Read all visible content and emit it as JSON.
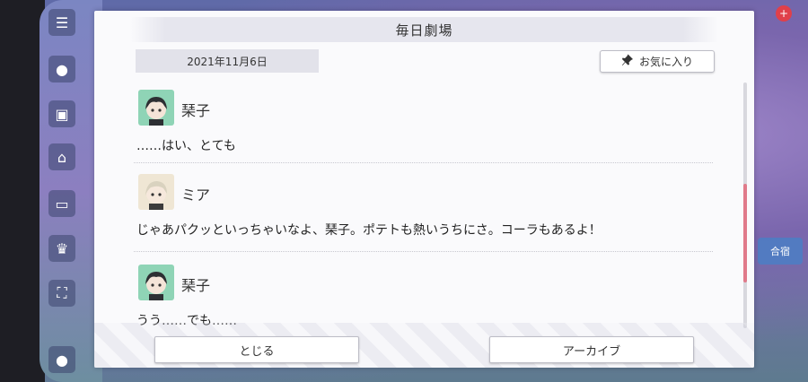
{
  "dialog": {
    "title": "毎日劇場",
    "date": "2021年11月6日",
    "favorite_label": "お気に入り",
    "entries": [
      {
        "speaker": "琹子",
        "text": "……はい、とても",
        "avatar": "kotoko-avatar"
      },
      {
        "speaker": "ミア",
        "text": "じゃあパクッといっちゃいなよ、琹子。ポテトも熱いうちにさ。コーラもあるよ！",
        "avatar": "mia-avatar"
      },
      {
        "speaker": "琹子",
        "text": "うう……でも……",
        "avatar": "kotoko-avatar"
      }
    ],
    "close_label": "とじる",
    "archive_label": "アーカイブ"
  },
  "background": {
    "right_badge": "+",
    "right_label": "合宿"
  },
  "colors": {
    "accent_scroll": "#e07a8a",
    "badge_red": "#e0404a"
  }
}
